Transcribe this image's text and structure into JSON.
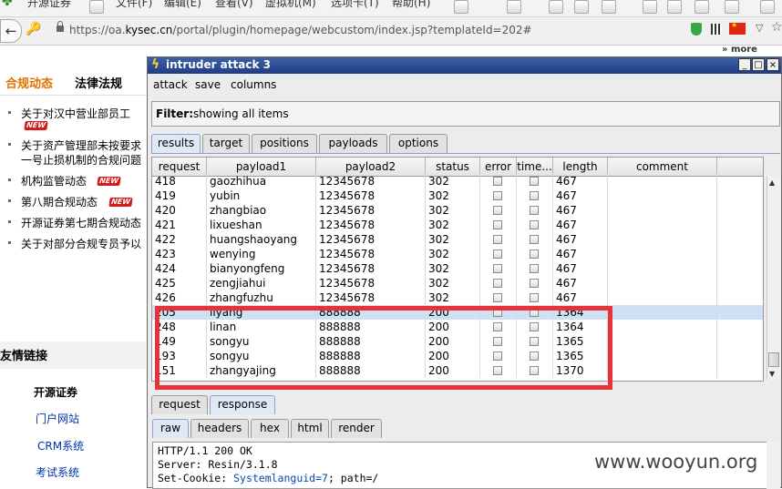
{
  "browser": {
    "tab_title": "开源证券",
    "menu": [
      "文件(F)",
      "编辑(E)",
      "查看(V)",
      "虚拟机(M)",
      "选项卡(T)",
      "帮助(H)"
    ],
    "url_prefix": "https://oa.",
    "url_domain": "kysec.cn",
    "url_rest": "/portal/plugin/homepage/webcustom/index.jsp?templateId=202#",
    "more_label": "more"
  },
  "page": {
    "tabs": [
      "合规动态",
      "法律法规"
    ],
    "news": [
      {
        "text": "关于对汉中营业部员工",
        "new": true
      },
      {
        "text": "关于资产管理部未按要求",
        "line2": "一号止损机制的合规问题",
        "new": false
      },
      {
        "text": "机构监管动态",
        "new": true
      },
      {
        "text": "第八期合规动态",
        "new": true
      },
      {
        "text": "开源证券第七期合规动态",
        "new": false
      },
      {
        "text": "关于对部分合规专员予以",
        "new": false
      }
    ],
    "new_badge": "NEW",
    "friends_title": "友情链接",
    "friend_links": [
      "开源证券",
      "门户网站",
      "CRM系统",
      "考试系统"
    ]
  },
  "intruder": {
    "title": "intruder attack 3",
    "window_buttons": [
      "_",
      "□",
      "×"
    ],
    "menu": [
      "attack",
      "save",
      "columns"
    ],
    "filter_label": "Filter:",
    "filter_value": "showing all items",
    "tabs": [
      "results",
      "target",
      "positions",
      "payloads",
      "options"
    ],
    "columns": [
      "request",
      "payload1",
      "payload2",
      "status",
      "error",
      "time...",
      "length",
      "comment"
    ],
    "rows": [
      {
        "request": "418",
        "payload1": "gaozhihua",
        "payload2": "12345678",
        "status": "302",
        "length": "467",
        "hl": false
      },
      {
        "request": "419",
        "payload1": "yubin",
        "payload2": "12345678",
        "status": "302",
        "length": "467",
        "hl": false
      },
      {
        "request": "420",
        "payload1": "zhangbiao",
        "payload2": "12345678",
        "status": "302",
        "length": "467",
        "hl": false
      },
      {
        "request": "421",
        "payload1": "lixueshan",
        "payload2": "12345678",
        "status": "302",
        "length": "467",
        "hl": false
      },
      {
        "request": "422",
        "payload1": "huangshaoyang",
        "payload2": "12345678",
        "status": "302",
        "length": "467",
        "hl": false
      },
      {
        "request": "423",
        "payload1": "wenying",
        "payload2": "12345678",
        "status": "302",
        "length": "467",
        "hl": false
      },
      {
        "request": "424",
        "payload1": "bianyongfeng",
        "payload2": "12345678",
        "status": "302",
        "length": "467",
        "hl": false
      },
      {
        "request": "425",
        "payload1": "zengjiahui",
        "payload2": "12345678",
        "status": "302",
        "length": "467",
        "hl": false
      },
      {
        "request": "426",
        "payload1": "zhangfuzhu",
        "payload2": "12345678",
        "status": "302",
        "length": "467",
        "hl": false
      },
      {
        "request": "205",
        "payload1": "liyang",
        "payload2": "888888",
        "status": "200",
        "length": "1364",
        "hl": true
      },
      {
        "request": "248",
        "payload1": "linan",
        "payload2": "888888",
        "status": "200",
        "length": "1364",
        "hl": false
      },
      {
        "request": "149",
        "payload1": "songyu",
        "payload2": "888888",
        "status": "200",
        "length": "1365",
        "hl": false
      },
      {
        "request": "193",
        "payload1": "songyu",
        "payload2": "888888",
        "status": "200",
        "length": "1365",
        "hl": false
      },
      {
        "request": "151",
        "payload1": "zhangyajing",
        "payload2": "888888",
        "status": "200",
        "length": "1370",
        "hl": false
      }
    ],
    "detail_tabs": [
      "request",
      "response"
    ],
    "view_tabs": [
      "raw",
      "headers",
      "hex",
      "html",
      "render"
    ],
    "response_lines": {
      "l1": "HTTP/1.1 200 OK",
      "l2": "Server: Resin/3.1.8",
      "l3_key": "Set-Cookie: ",
      "l3_val": "Systemlanguid=7",
      "l3_rest": "; path=/"
    }
  },
  "watermark": "www.wooyun.org",
  "colors": {
    "highlight_box": "#e8323a",
    "title_bar": "#1f3d86",
    "selected_row": "#cfe0f5"
  }
}
